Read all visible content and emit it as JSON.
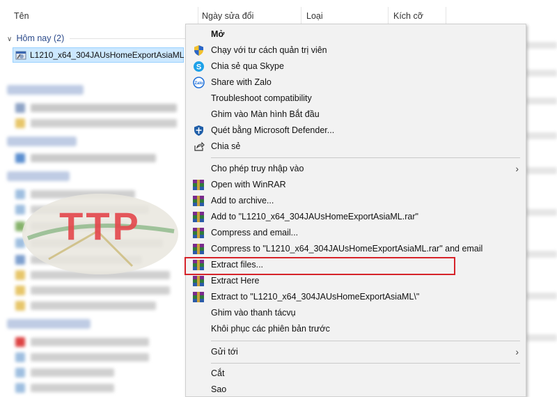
{
  "explorer": {
    "columns": [
      "Tên",
      "Ngày sửa đổi",
      "Loại",
      "Kích cỡ"
    ],
    "group_label": "Hôm nay (2)",
    "selected_file": "L1210_x64_304JAUsHomeExportAsiaML"
  },
  "watermark": {
    "text": "TTP"
  },
  "context_menu": {
    "items": [
      {
        "label": "Mở",
        "icon": "none",
        "bold": true
      },
      {
        "label": "Chạy với tư cách quản trị viên",
        "icon": "uac-shield-icon"
      },
      {
        "label": "Chia sẻ qua Skype",
        "icon": "skype-icon"
      },
      {
        "label": "Share with Zalo",
        "icon": "zalo-icon"
      },
      {
        "label": "Troubleshoot compatibility",
        "icon": "none"
      },
      {
        "label": "Ghim vào Màn hình Bắt đầu",
        "icon": "none"
      },
      {
        "label": "Quét bằng Microsoft Defender...",
        "icon": "defender-icon"
      },
      {
        "label": "Chia sẻ",
        "icon": "share-icon"
      },
      {
        "label": "Cho phép truy nhập vào",
        "icon": "none",
        "submenu": true
      },
      {
        "label": "Open with WinRAR",
        "icon": "winrar-icon"
      },
      {
        "label": "Add to archive...",
        "icon": "winrar-icon"
      },
      {
        "label": "Add to \"L1210_x64_304JAUsHomeExportAsiaML.rar\"",
        "icon": "winrar-icon"
      },
      {
        "label": "Compress and email...",
        "icon": "winrar-icon"
      },
      {
        "label": "Compress to \"L1210_x64_304JAUsHomeExportAsiaML.rar\" and email",
        "icon": "winrar-icon"
      },
      {
        "label": "Extract files...",
        "icon": "winrar-icon",
        "highlighted": true
      },
      {
        "label": "Extract Here",
        "icon": "winrar-icon"
      },
      {
        "label": "Extract to \"L1210_x64_304JAUsHomeExportAsiaML\\\"",
        "icon": "winrar-icon"
      },
      {
        "label": "Ghim vào thanh tácvụ",
        "icon": "none"
      },
      {
        "label": "Khôi phục các phiên bản trước",
        "icon": "none"
      },
      {
        "label": "Gửi tới",
        "icon": "none",
        "submenu": true
      },
      {
        "label": "Cắt",
        "icon": "none"
      },
      {
        "label": "Sao",
        "icon": "none"
      }
    ],
    "submenu_arrow": "›",
    "highlight_color": "#d6232a"
  }
}
